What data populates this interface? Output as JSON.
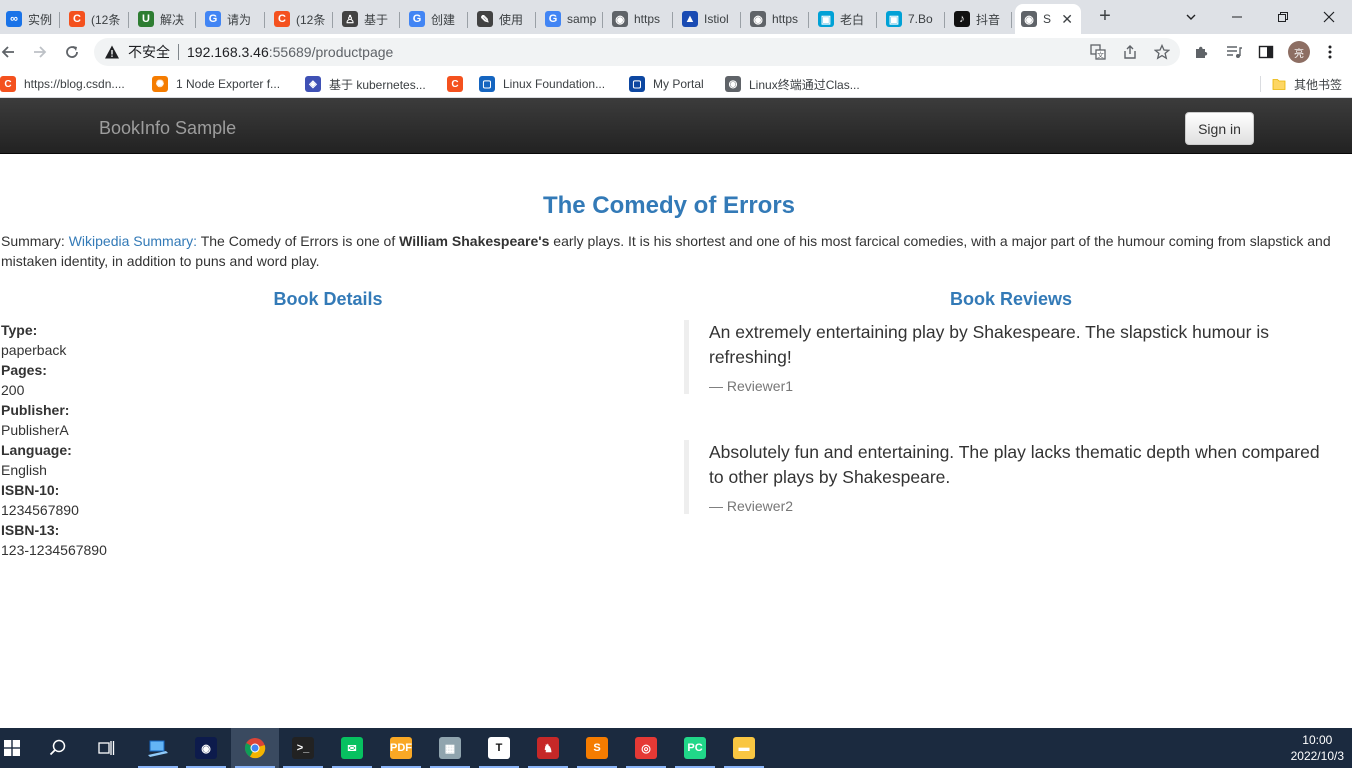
{
  "browser": {
    "tabs": [
      {
        "label": "实例",
        "fav_color": "#1a73e8",
        "fav_glyph": "∞"
      },
      {
        "label": "(12条",
        "fav_color": "#f4511e",
        "fav_glyph": "C"
      },
      {
        "label": "解决",
        "fav_color": "#2e7d32",
        "fav_glyph": "U"
      },
      {
        "label": "请为",
        "fav_color": "#4285f4",
        "fav_glyph": "G"
      },
      {
        "label": "(12条",
        "fav_color": "#f4511e",
        "fav_glyph": "C"
      },
      {
        "label": "基于",
        "fav_color": "#424242",
        "fav_glyph": "♙"
      },
      {
        "label": "创建",
        "fav_color": "#4285f4",
        "fav_glyph": "G"
      },
      {
        "label": "使用",
        "fav_color": "#424242",
        "fav_glyph": "✎"
      },
      {
        "label": "samp",
        "fav_color": "#4285f4",
        "fav_glyph": "G"
      },
      {
        "label": "https",
        "fav_color": "#5f6368",
        "fav_glyph": "◉"
      },
      {
        "label": "Istiol",
        "fav_color": "#1a4bb3",
        "fav_glyph": "▲"
      },
      {
        "label": "https",
        "fav_color": "#5f6368",
        "fav_glyph": "◉"
      },
      {
        "label": "老白",
        "fav_color": "#00a1d6",
        "fav_glyph": "▣"
      },
      {
        "label": "7.Bo",
        "fav_color": "#00a1d6",
        "fav_glyph": "▣"
      },
      {
        "label": "抖音",
        "fav_color": "#111111",
        "fav_glyph": "♪"
      },
      {
        "label": "S",
        "fav_color": "#5f6368",
        "fav_glyph": "◉"
      }
    ],
    "active_tab_index": 15,
    "new_tab_glyph": "+",
    "url": {
      "insecure_label": "不安全",
      "host": "192.168.3.46",
      "rest": ":55689/productpage"
    },
    "profile_initial": "亮",
    "bookmarks": [
      {
        "label": "https://blog.csdn....",
        "fav_color": "#f4511e",
        "fav_glyph": "C"
      },
      {
        "label": "1 Node Exporter f...",
        "fav_color": "#f57c00",
        "fav_glyph": "✺"
      },
      {
        "label": "基于 kubernetes...",
        "fav_color": "#3f51b5",
        "fav_glyph": "◈"
      },
      {
        "label": "",
        "fav_color": "#f4511e",
        "fav_glyph": "C"
      },
      {
        "label": "Linux Foundation...",
        "fav_color": "#1565c0",
        "fav_glyph": "▢"
      },
      {
        "label": "My Portal",
        "fav_color": "#0d47a1",
        "fav_glyph": "▢"
      },
      {
        "label": "Linux终端通过Clas...",
        "fav_color": "#5f6368",
        "fav_glyph": "◉"
      }
    ],
    "other_bookmarks": "其他书签"
  },
  "app": {
    "brand": "BookInfo Sample",
    "signin_label": "Sign in",
    "title": "The Comedy of Errors",
    "summary": {
      "prefix": "Summary: ",
      "link": "Wikipedia Summary:",
      "text1": " The Comedy of Errors is one of ",
      "bold": "William Shakespeare's",
      "text2": " early plays. It is his shortest and one of his most farcical comedies, with a major part of the humour coming from slapstick and mistaken identity, in addition to puns and word play."
    },
    "details_heading": "Book Details",
    "reviews_heading": "Book Reviews",
    "details": [
      {
        "label": "Type:",
        "value": "paperback"
      },
      {
        "label": "Pages:",
        "value": "200"
      },
      {
        "label": "Publisher:",
        "value": "PublisherA"
      },
      {
        "label": "Language:",
        "value": "English"
      },
      {
        "label": "ISBN-10:",
        "value": "1234567890"
      },
      {
        "label": "ISBN-13:",
        "value": "123-1234567890"
      }
    ],
    "reviews": [
      {
        "text": "An extremely entertaining play by Shakespeare. The slapstick humour is refreshing!",
        "by": "— Reviewer1"
      },
      {
        "text": "Absolutely fun and entertaining. The play lacks thematic depth when compared to other plays by Shakespeare.",
        "by": "— Reviewer2"
      }
    ]
  },
  "taskbar": {
    "time": "10:00",
    "date": "2022/10/3",
    "apps": [
      {
        "name": "network-app",
        "color": "#1e88e5",
        "glyph": ""
      },
      {
        "name": "dark-app",
        "color": "#0d1b4c",
        "glyph": "◉"
      },
      {
        "name": "chrome",
        "color": "#ffffff",
        "glyph": ""
      },
      {
        "name": "terminal",
        "color": "#222222",
        "glyph": ">_"
      },
      {
        "name": "wechat",
        "color": "#07c160",
        "glyph": "✉"
      },
      {
        "name": "pdf-app",
        "color": "#f9a825",
        "glyph": "PDF"
      },
      {
        "name": "remote-app",
        "color": "#90a4ae",
        "glyph": "▦"
      },
      {
        "name": "typora",
        "color": "#ffffff",
        "glyph": "T"
      },
      {
        "name": "bird-app",
        "color": "#c62828",
        "glyph": "♞"
      },
      {
        "name": "sublime",
        "color": "#f57c00",
        "glyph": "S"
      },
      {
        "name": "netease-music",
        "color": "#e53935",
        "glyph": "◎"
      },
      {
        "name": "pycharm",
        "color": "#21d789",
        "glyph": "PC"
      },
      {
        "name": "file-explorer",
        "color": "#f9c642",
        "glyph": "▬"
      }
    ]
  }
}
